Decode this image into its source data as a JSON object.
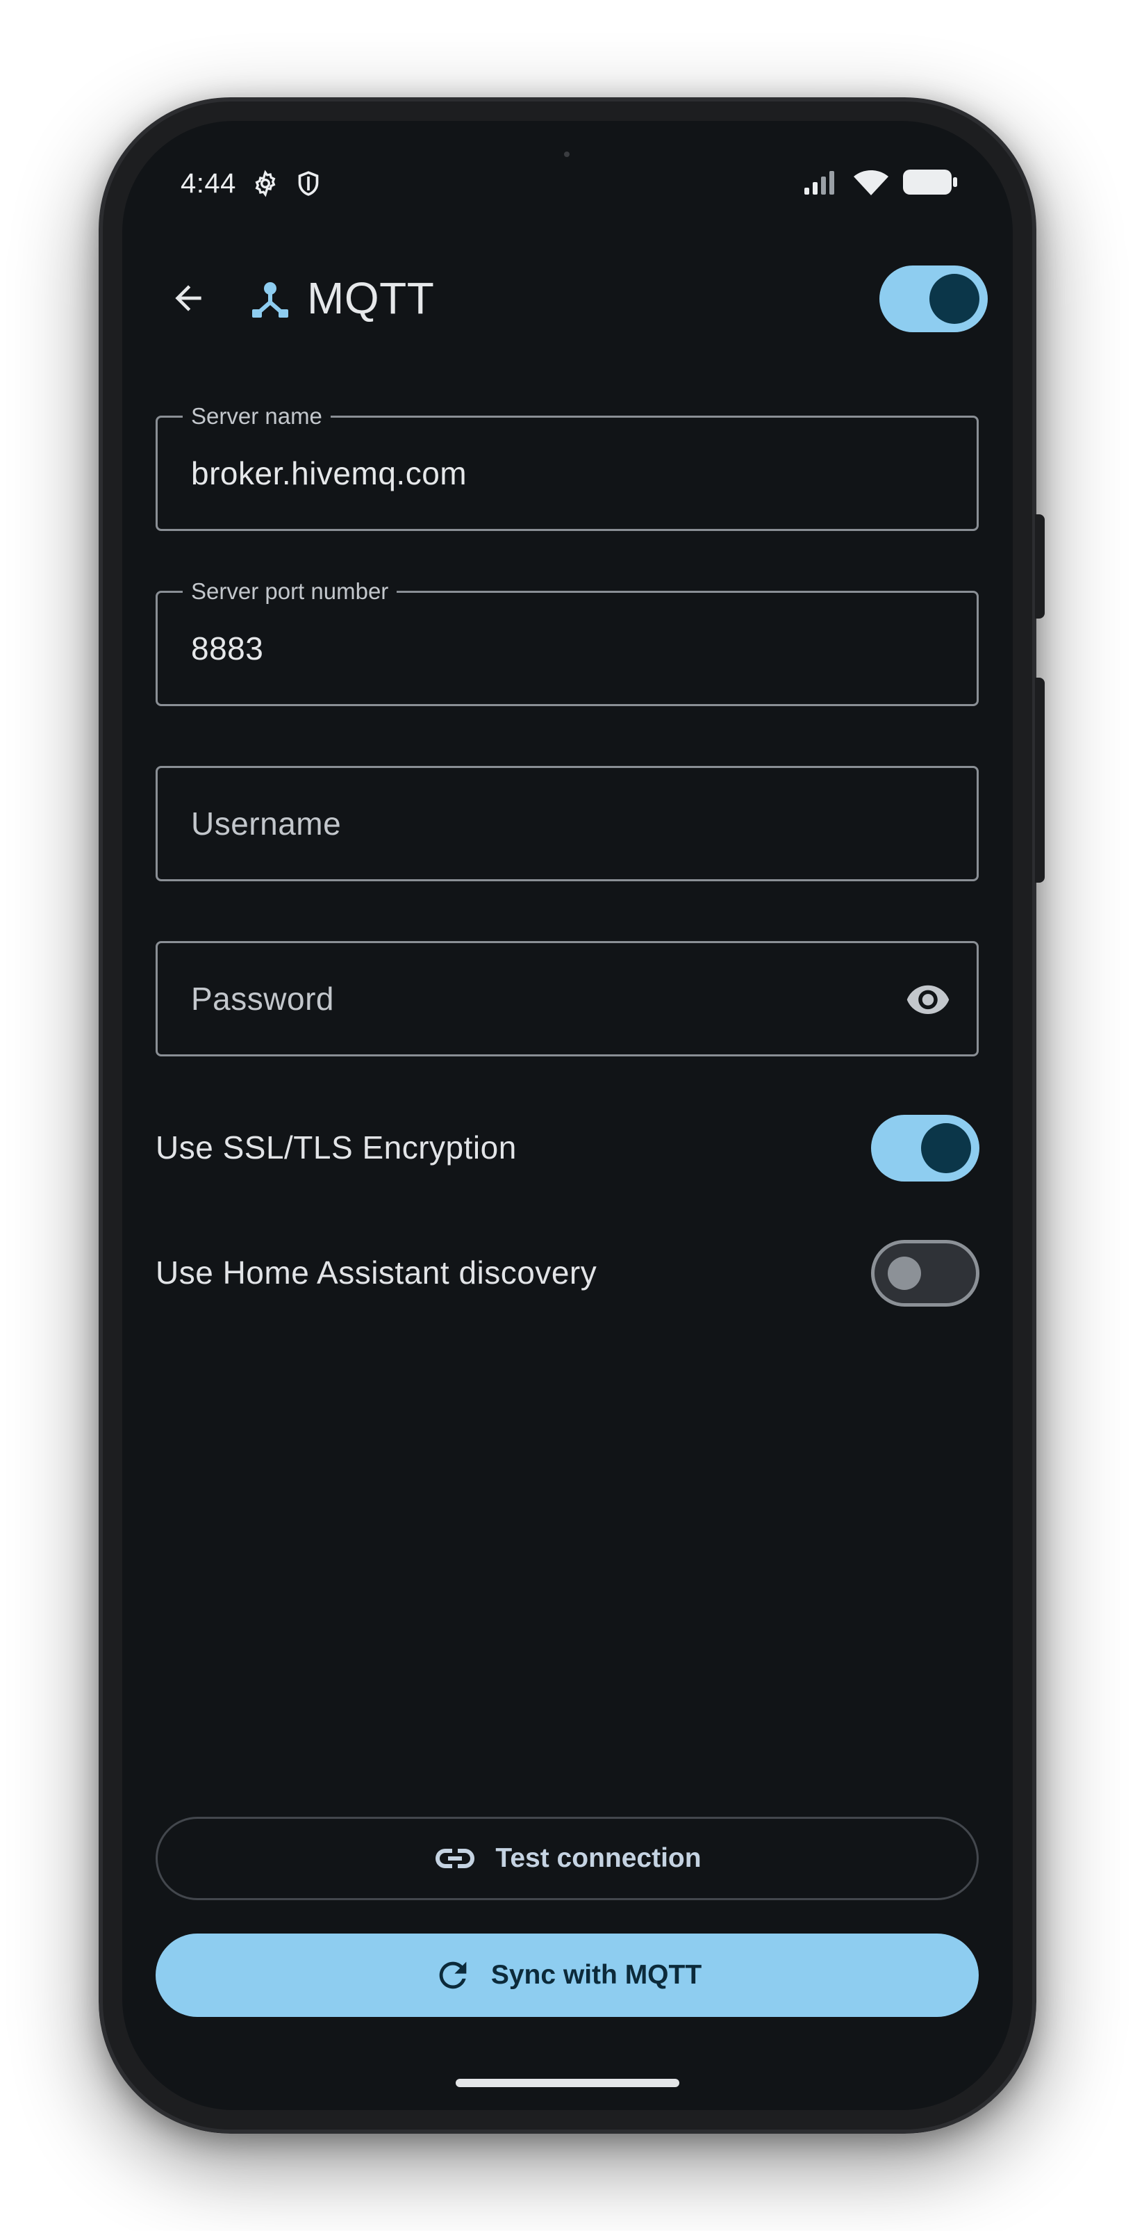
{
  "status_bar": {
    "time": "4:44",
    "icons": [
      "settings-icon",
      "shield-icon",
      "signal-icon",
      "wifi-icon",
      "battery-icon"
    ]
  },
  "app_bar": {
    "title": "MQTT",
    "logo_icon": "mqtt-broker-icon",
    "back_icon": "arrow-back-icon",
    "master_switch_on": true
  },
  "form": {
    "server_name": {
      "label": "Server name",
      "value": "broker.hivemq.com"
    },
    "server_port": {
      "label": "Server port number",
      "value": "8883"
    },
    "username": {
      "placeholder": "Username",
      "value": ""
    },
    "password": {
      "placeholder": "Password",
      "value": "",
      "toggle_icon": "eye-icon"
    }
  },
  "options": {
    "ssl": {
      "label": "Use SSL/TLS Encryption",
      "on": true
    },
    "discovery": {
      "label": "Use Home Assistant discovery",
      "on": false
    }
  },
  "actions": {
    "test_connection": {
      "label": "Test connection",
      "icon": "link-icon"
    },
    "sync": {
      "label": "Sync with MQTT",
      "icon": "sync-icon"
    }
  },
  "colors": {
    "background": "#111417",
    "accent": "#8ecdf0",
    "accent_dark": "#0b3649",
    "outline": "#8a8f95"
  }
}
